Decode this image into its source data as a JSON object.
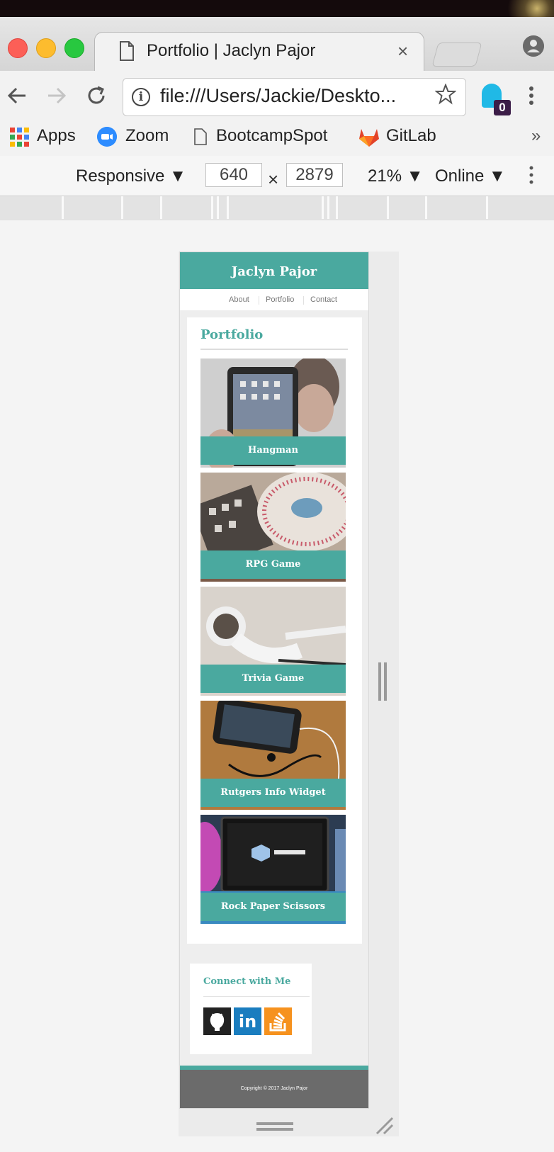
{
  "browser": {
    "tab_title": "Portfolio | Jaclyn Pajor",
    "tab_close": "×",
    "url": "file:///Users/Jackie/Deskto...",
    "extension_badge": "0",
    "bookmarks": [
      {
        "label": "Apps",
        "icon": "apps-grid-icon"
      },
      {
        "label": "Zoom",
        "icon": "zoom-icon"
      },
      {
        "label": "BootcampSpot",
        "icon": "document-icon"
      },
      {
        "label": "GitLab",
        "icon": "gitlab-icon"
      }
    ],
    "more_bookmarks": "»"
  },
  "devtools": {
    "device": "Responsive ▼",
    "width": "640",
    "times": "×",
    "height": "2879",
    "zoom": "21% ▼",
    "throttle": "Online ▼"
  },
  "site": {
    "title": "Jaclyn Pajor",
    "nav": [
      "About",
      "Portfolio",
      "Contact"
    ],
    "section_title": "Portfolio",
    "projects": [
      {
        "name": "Hangman",
        "image": "person-holding-tablet"
      },
      {
        "name": "RPG Game",
        "image": "dj-turntable"
      },
      {
        "name": "Trivia Game",
        "image": "white-earbuds"
      },
      {
        "name": "Rutgers Info Widget",
        "image": "phone-with-earphones"
      },
      {
        "name": "Rock Paper Scissors",
        "image": "led-tv"
      }
    ],
    "connect_title": "Connect with Me",
    "social": [
      {
        "name": "github-icon"
      },
      {
        "name": "linkedin-icon",
        "text": "in"
      },
      {
        "name": "stackoverflow-icon"
      }
    ],
    "footer": "Copyright © 2017 Jaclyn Pajor"
  },
  "colors": {
    "accent": "#4aa99f",
    "footer": "#6b6b6b",
    "linkedin": "#1a7dbf",
    "stackoverflow": "#f6921e",
    "github": "#222222"
  }
}
